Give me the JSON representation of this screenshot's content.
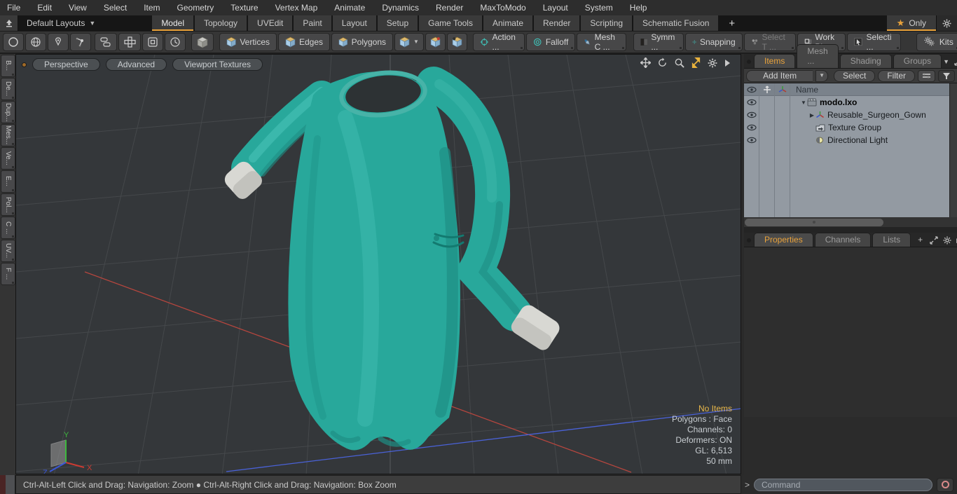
{
  "menu_bar": {
    "items": [
      "File",
      "Edit",
      "View",
      "Select",
      "Item",
      "Geometry",
      "Texture",
      "Vertex Map",
      "Animate",
      "Dynamics",
      "Render",
      "MaxToModo",
      "Layout",
      "System",
      "Help"
    ]
  },
  "layout_bar": {
    "preset_label": "Default Layouts",
    "tabs": [
      {
        "label": "Model"
      },
      {
        "label": "Topology"
      },
      {
        "label": "UVEdit"
      },
      {
        "label": "Paint"
      },
      {
        "label": "Layout"
      },
      {
        "label": "Setup"
      },
      {
        "label": "Game Tools"
      },
      {
        "label": "Animate"
      },
      {
        "label": "Render"
      },
      {
        "label": "Scripting"
      },
      {
        "label": "Schematic Fusion"
      }
    ],
    "active_tab": "Model",
    "add_tab_label": "+",
    "only_label": "Only"
  },
  "toolbar": {
    "selection_modes": {
      "vertices": "Vertices",
      "edges": "Edges",
      "polygons": "Polygons"
    },
    "tools": {
      "action": "Action  ...",
      "falloff": "Falloff",
      "mesh_constraint": "Mesh C ...",
      "symmetry": "Symm ...",
      "snapping": "Snapping",
      "select_through": "Select T ...",
      "work_plane": "Work Pl...",
      "selection_sets": "Selecti ...",
      "kits": "Kits"
    }
  },
  "left_toolbox": {
    "tabs": [
      "B...",
      "De...",
      "Dup...",
      "Mes...",
      "Ve...",
      "E...",
      "Pol...",
      "C ...",
      "UV...",
      "F ..."
    ]
  },
  "viewport": {
    "mode_buttons": [
      "Perspective",
      "Advanced",
      "Viewport Textures"
    ],
    "stats": {
      "selection": "No Items",
      "polygons": "Polygons : Face",
      "channels": "Channels: 0",
      "deformers": "Deformers: ON",
      "gl": "GL: 6,513",
      "grid_size": "50 mm"
    },
    "axis_labels": {
      "x": "X",
      "y": "Y",
      "z": "Z"
    },
    "colors": {
      "gown": "#28a89b",
      "gown_dark": "#1e8e84",
      "gown_light": "#43bfb3",
      "cuff": "#d8d8d3",
      "background": "#34373a",
      "grid": "#45484b",
      "x_axis": "#b5463e",
      "z_axis": "#4a62d8",
      "accent_orange": "#e9a23b"
    }
  },
  "items_panel": {
    "tabs": [
      {
        "label": "Items"
      },
      {
        "label": "Mesh ..."
      },
      {
        "label": "Shading"
      },
      {
        "label": "Groups"
      }
    ],
    "active_tab": "Items",
    "add_item_label": "Add Item",
    "select_label": "Select",
    "filter_label": "Filter",
    "name_column": "Name",
    "tree": [
      {
        "label": "modo.lxo",
        "icon": "scene",
        "expanded": true
      },
      {
        "label": "Reusable_Surgeon_Gown",
        "icon": "locator",
        "collapsed": true
      },
      {
        "label": "Texture Group",
        "icon": "texture-group"
      },
      {
        "label": "Directional Light",
        "icon": "directional-light"
      }
    ]
  },
  "properties_panel": {
    "tabs": [
      {
        "label": "Properties"
      },
      {
        "label": "Channels"
      },
      {
        "label": "Lists"
      },
      {
        "label": "+"
      }
    ],
    "active_tab": "Properties"
  },
  "status_bar": {
    "text": "Ctrl-Alt-Left Click and Drag: Navigation: Zoom ● Ctrl-Alt-Right Click and Drag: Navigation: Box Zoom"
  },
  "command_bar": {
    "prompt": ">",
    "placeholder": "Command"
  }
}
